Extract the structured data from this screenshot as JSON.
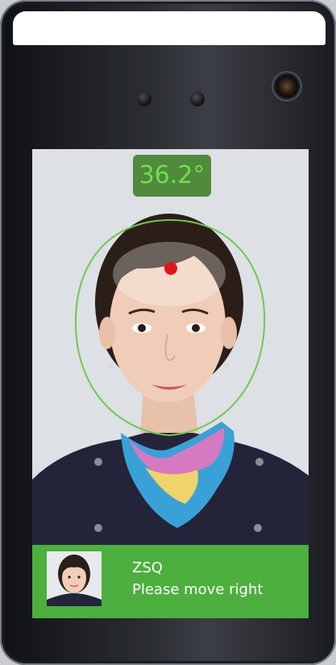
{
  "temperature": {
    "value": "36.2°"
  },
  "recognition": {
    "name": "ZSQ",
    "message": "Please move right"
  },
  "colors": {
    "accent_green": "#4caf3e",
    "badge_bg": "#4f8a3d",
    "badge_text": "#6fe04d"
  },
  "icons": {
    "forehead_marker": "red-dot-icon"
  }
}
